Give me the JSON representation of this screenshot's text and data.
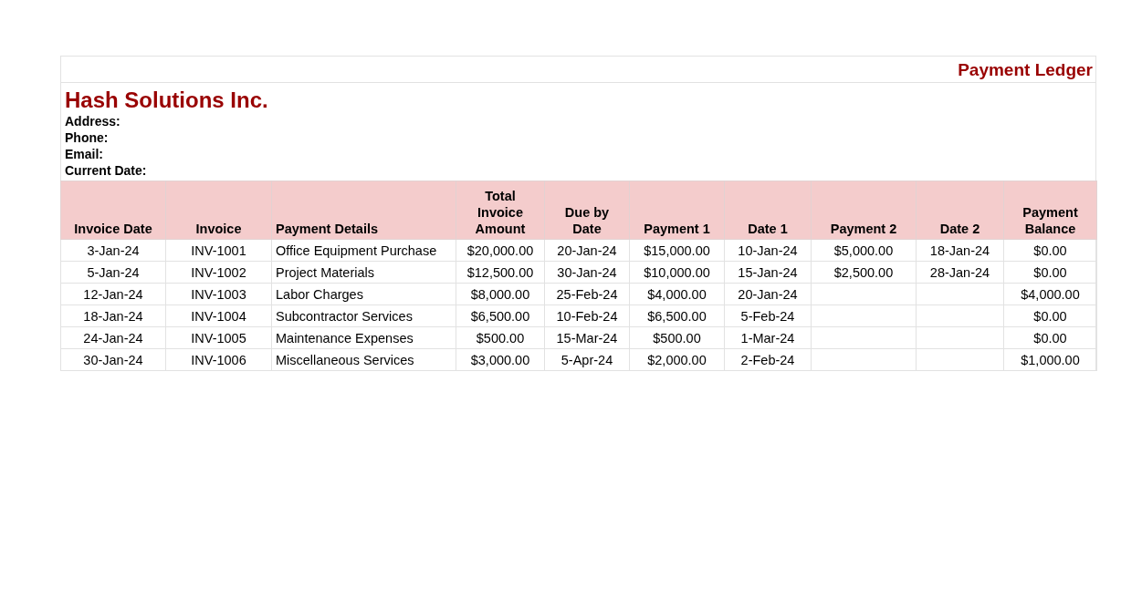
{
  "sheet_title": "Payment Ledger",
  "company": {
    "name": "Hash Solutions Inc.",
    "fields": [
      "Address:",
      "Phone:",
      "Email:",
      "Current Date:"
    ]
  },
  "table": {
    "columns": [
      "Invoice Date",
      "Invoice",
      "Payment Details",
      "Total\nInvoice\nAmount",
      "Due by\nDate",
      "Payment 1",
      "Date 1",
      "Payment 2",
      "Date 2",
      "Payment\nBalance"
    ],
    "rows": [
      [
        "3-Jan-24",
        "INV-1001",
        "Office Equipment Purchase",
        "$20,000.00",
        "20-Jan-24",
        "$15,000.00",
        "10-Jan-24",
        "$5,000.00",
        "18-Jan-24",
        "$0.00"
      ],
      [
        "5-Jan-24",
        "INV-1002",
        "Project Materials",
        "$12,500.00",
        "30-Jan-24",
        "$10,000.00",
        "15-Jan-24",
        "$2,500.00",
        "28-Jan-24",
        "$0.00"
      ],
      [
        "12-Jan-24",
        "INV-1003",
        "Labor Charges",
        "$8,000.00",
        "25-Feb-24",
        "$4,000.00",
        "20-Jan-24",
        null,
        null,
        "$4,000.00"
      ],
      [
        "18-Jan-24",
        "INV-1004",
        "Subcontractor Services",
        "$6,500.00",
        "10-Feb-24",
        "$6,500.00",
        "5-Feb-24",
        null,
        null,
        "$0.00"
      ],
      [
        "24-Jan-24",
        "INV-1005",
        "Maintenance Expenses",
        "$500.00",
        "15-Mar-24",
        "$500.00",
        "1-Mar-24",
        null,
        null,
        "$0.00"
      ],
      [
        "30-Jan-24",
        "INV-1006",
        "Miscellaneous Services",
        "$3,000.00",
        "5-Apr-24",
        "$2,000.00",
        "2-Feb-24",
        null,
        null,
        "$1,000.00"
      ]
    ]
  }
}
